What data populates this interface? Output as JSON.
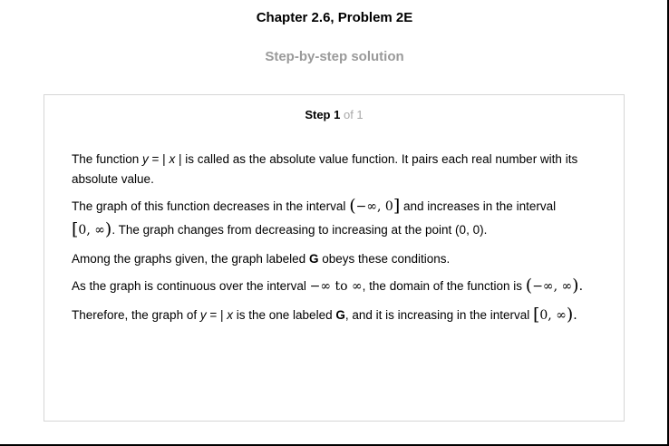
{
  "header": {
    "chapter_title": "Chapter 2.6, Problem 2E",
    "subtitle": "Step-by-step solution"
  },
  "step": {
    "label": "Step 1",
    "of": "of 1"
  },
  "paragraphs": {
    "p1": {
      "t1": "The function ",
      "y": "y",
      "t2": " = | ",
      "x": "x",
      "t3": " | is called as the absolute value function. It pairs each real number with its absolute value."
    },
    "p2": {
      "t1": "The graph of this function decreases in the interval ",
      "interval_dec_open": "(",
      "interval_dec_body": "−∞, 0",
      "interval_dec_close": "]",
      "t2": " and increases in the interval ",
      "interval_inc_open": "[",
      "interval_inc_body": "0, ∞",
      "interval_inc_close": ")",
      "t3": ". The graph changes from decreasing to increasing at the point (0, 0)."
    },
    "p3": {
      "t1": "Among the graphs given, the graph labeled ",
      "label": "G",
      "t2": " obeys these conditions."
    },
    "p4": {
      "t1": "As the graph is continuous over the interval ",
      "interval": "−∞ to ∞",
      "t2": ", the domain of the function is ",
      "domain_open": "(",
      "domain_body": "−∞, ∞",
      "domain_close": ")",
      "t3": "."
    },
    "p5": {
      "t1": "Therefore, the graph of ",
      "y": "y",
      "t2": " = | ",
      "x": "x",
      "t3": " is the one labeled ",
      "label": "G",
      "t4": ", and it is increasing in the interval ",
      "interval_open": "[",
      "interval_body": "0, ∞",
      "interval_close": ")",
      "t5": "."
    }
  }
}
